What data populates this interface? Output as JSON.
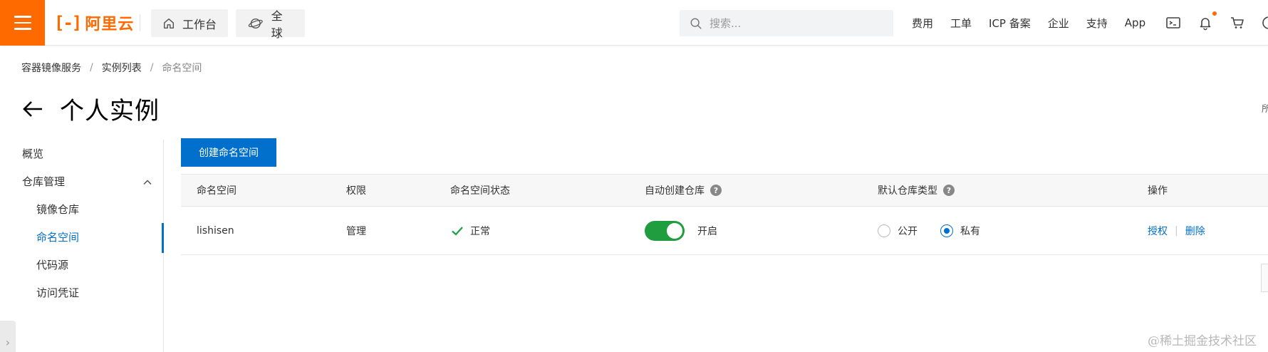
{
  "topbar": {
    "logo_text": "阿里云",
    "workbench_label": "工作台",
    "region_label": "全球",
    "search_placeholder": "搜索...",
    "nav_links": [
      "费用",
      "工单",
      "ICP 备案",
      "企业",
      "支持",
      "App"
    ],
    "brand_color": "#ff6a00"
  },
  "breadcrumb": {
    "items": [
      "容器镜像服务",
      "实例列表"
    ],
    "current": "命名空间"
  },
  "page": {
    "title": "个人实例",
    "right_clip_text": "所"
  },
  "sidebar": {
    "overview": "概览",
    "repo_management": "仓库管理",
    "image_repo": "镜像仓库",
    "namespace": "命名空间",
    "code_source": "代码源",
    "access_credential": "访问凭证"
  },
  "main": {
    "create_button": "创建命名空间",
    "columns": {
      "namespace": "命名空间",
      "permission": "权限",
      "status": "命名空间状态",
      "auto_create": "自动创建仓库",
      "default_type": "默认仓库类型",
      "actions": "操作"
    },
    "rows": [
      {
        "namespace": "lishisen",
        "permission": "管理",
        "status": "正常",
        "auto_create_label": "开启",
        "auto_create_on": true,
        "type_public": "公开",
        "type_private": "私有",
        "selected_type": "私有",
        "action_authorize": "授权",
        "action_delete": "删除"
      }
    ],
    "accent_color": "#0070cc",
    "success_color": "#1f9d3f"
  },
  "watermark": "@稀土掘金技术社区"
}
